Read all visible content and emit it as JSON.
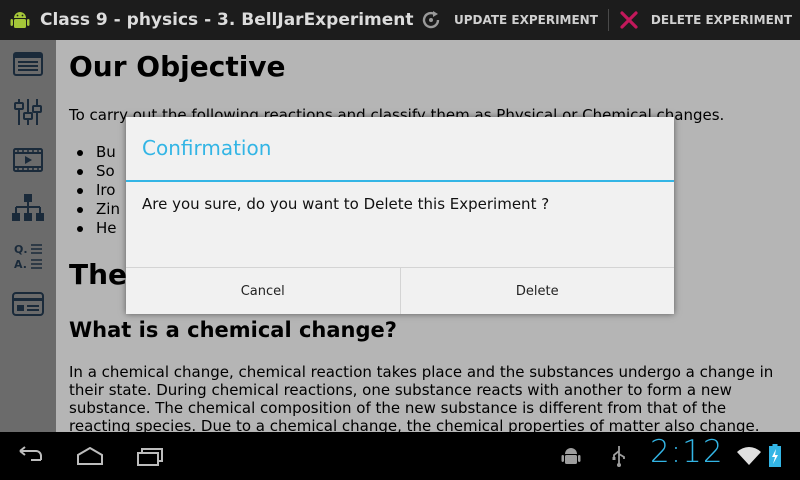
{
  "actionbar": {
    "title": "Class 9 - physics - 3. BellJarExperiment",
    "update_label": "UPDATE EXPERIMENT",
    "delete_label": "DELETE EXPERIMENT",
    "update_icon": "refresh-icon",
    "delete_icon": "close-x-icon",
    "delete_color": "#c2185b"
  },
  "toolbar": {
    "icons": [
      "list-view-icon",
      "sliders-icon",
      "video-icon",
      "hierarchy-icon",
      "qa-icon",
      "card-icon"
    ]
  },
  "content": {
    "heading": "Our Objective",
    "intro": "To carry out the following reactions and classify them as Physical or Chemical changes.",
    "bullets": [
      "Bu",
      "So",
      "Iro",
      "Zin",
      "He"
    ],
    "partial_heading": "The",
    "subheading": "What is a chemical change?",
    "paragraph": "In a chemical change, chemical reaction takes place and the substances undergo a change in their state.  During chemical reactions, one substance reacts with another to form a new substance. The chemical composition of the new substance is different from that of the reacting species.  Due to a chemical change, the chemical properties of matter also change. That means the product is entirely"
  },
  "dialog": {
    "title": "Confirmation",
    "message": "Are you sure, do you want to Delete this Experiment ?",
    "cancel_label": "Cancel",
    "delete_label": "Delete",
    "accent_color": "#33b5e5"
  },
  "systembar": {
    "clock": "2:12",
    "clock_color": "#33b5e5"
  }
}
